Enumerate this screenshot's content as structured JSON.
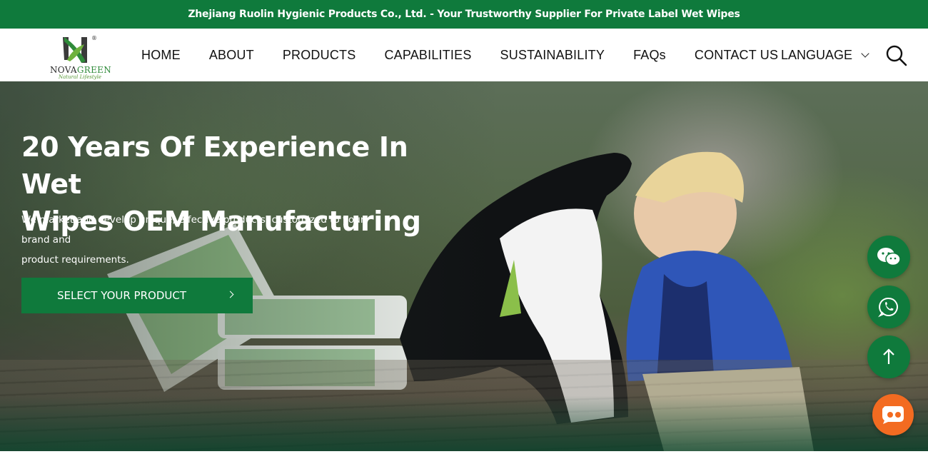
{
  "announcement": "Zhejiang Ruolin Hygienic Products Co., Ltd. - Your Trustworthy Supplier For Private Label Wet Wipes",
  "logo": {
    "letter": "N",
    "registered": "®",
    "word_part1": "NOVA",
    "word_part2": "GREEN",
    "tagline": "Natural Lifestyle"
  },
  "nav": {
    "items": [
      {
        "label": "HOME"
      },
      {
        "label": "ABOUT"
      },
      {
        "label": "PRODUCTS"
      },
      {
        "label": "CAPABILITIES"
      },
      {
        "label": "SUSTAINABILITY"
      },
      {
        "label": "FAQs"
      },
      {
        "label": "CONTACT US"
      }
    ],
    "language_label": "LANGUAGE",
    "language_icon": "chevron-down-icon",
    "search_icon": "search-icon"
  },
  "hero": {
    "title_line1": "20 Years Of Experience In Wet",
    "title_line2": "Wipes OEM Manufacturing",
    "subtitle_line1": "We market and develop unique, effective products, customized to your brand and",
    "subtitle_line2": "product requirements.",
    "cta_label": "SELECT YOUR PRODUCT",
    "image_description_icons": [
      "dog-and-child-photo",
      "wet-wipes-packages"
    ]
  },
  "floating": {
    "wechat_icon": "wechat-icon",
    "whatsapp_icon": "whatsapp-icon",
    "back_to_top_icon": "arrow-up-icon",
    "chat_icon": "chat-bubble-icon"
  },
  "colors": {
    "brand_green": "#0f7a3c",
    "chat_orange": "#f36b21",
    "text_dark": "#111111",
    "white": "#ffffff"
  }
}
